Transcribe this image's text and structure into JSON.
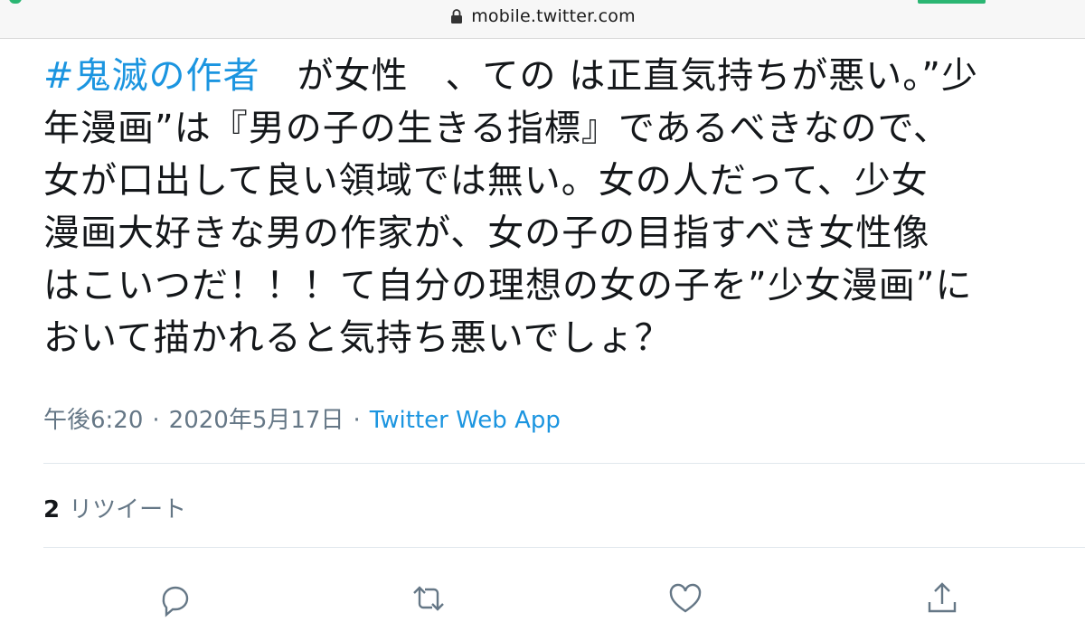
{
  "browser": {
    "url": "mobile.twitter.com",
    "icons": [
      "lock-icon"
    ],
    "accent_color": "#2bb673"
  },
  "tweet": {
    "hashtag": "#鬼滅の作者",
    "lines": [
      "　が女性　、ての は正直気持ちが悪い。”少",
      "年漫画”は『男の子の生きる指標』であるべきなので、",
      "女が口出して良い領域では無い。女の人だって、少女",
      "漫画大好きな男の作家が、女の子の目指すべき女性像",
      "はこいつだ！！！て自分の理想の女の子を”少女漫画”に",
      "おいて描かれると気持ち悪いでしょ？"
    ],
    "time": "午後6:20",
    "date": "2020年5月17日",
    "separator": "·",
    "source": "Twitter Web App",
    "link_color": "#1b95e0"
  },
  "stats": {
    "retweet_count": "2",
    "retweet_label": "リツイート"
  },
  "actions": {
    "icons": [
      "reply-icon",
      "retweet-icon",
      "like-icon",
      "share-icon"
    ]
  }
}
